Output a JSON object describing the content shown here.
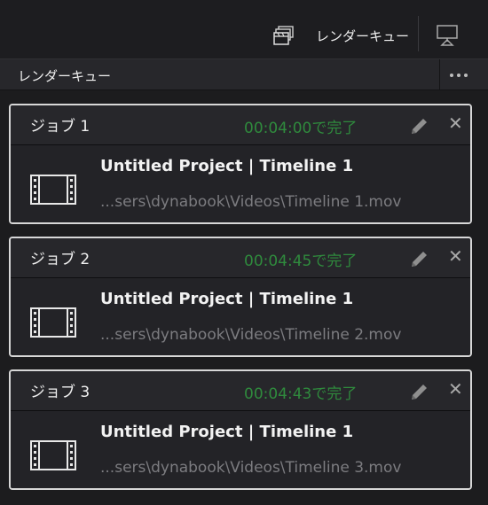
{
  "toolbar": {
    "render_queue_icon": "clapperboard-stack-icon",
    "render_queue_label": "レンダーキュー",
    "monitor_icon": "monitor-icon"
  },
  "panel": {
    "title": "レンダーキュー",
    "more_icon": "more-dots-icon"
  },
  "jobs": [
    {
      "name": "ジョブ 1",
      "status": "00:04:00で完了",
      "title": "Untitled Project | Timeline 1",
      "path": "...sers\\dynabook\\Videos\\Timeline 1.mov"
    },
    {
      "name": "ジョブ 2",
      "status": "00:04:45で完了",
      "title": "Untitled Project | Timeline 1",
      "path": "...sers\\dynabook\\Videos\\Timeline 2.mov"
    },
    {
      "name": "ジョブ 3",
      "status": "00:04:43で完了",
      "title": "Untitled Project | Timeline 1",
      "path": "...sers\\dynabook\\Videos\\Timeline 3.mov"
    }
  ],
  "colors": {
    "status_green": "#2f8a3d",
    "border": "#d7d7d7",
    "background": "#1c1c1e"
  }
}
